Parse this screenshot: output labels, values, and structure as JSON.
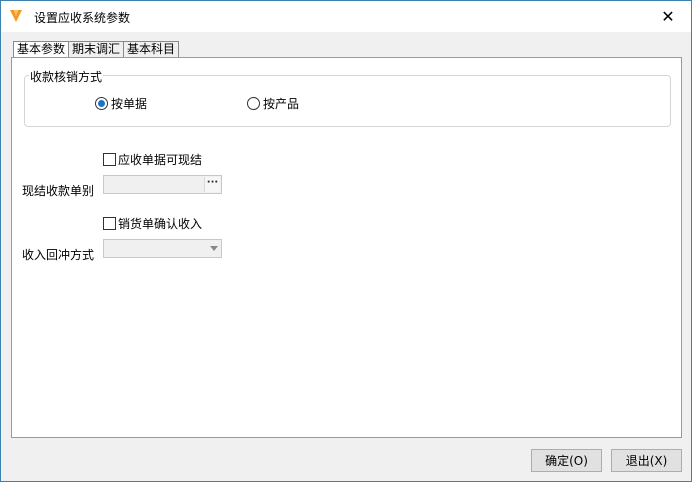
{
  "window": {
    "title": "设置应收系统参数",
    "close_glyph": "✕",
    "icon": "app-logo-icon"
  },
  "tabs": [
    {
      "label": "基本参数",
      "active": true
    },
    {
      "label": "期末调汇",
      "active": false
    },
    {
      "label": "基本科目",
      "active": false
    }
  ],
  "settlement_group": {
    "legend": "收款核销方式",
    "options": [
      {
        "label": "按单据",
        "checked": true
      },
      {
        "label": "按产品",
        "checked": false
      }
    ]
  },
  "checkbox_cash": {
    "label": "应收单据可现结",
    "checked": false
  },
  "cash_receipt_type": {
    "label": "现结收款单别",
    "value": "",
    "button_glyph": "···"
  },
  "checkbox_sales_confirm": {
    "label": "销货单确认收入",
    "checked": false
  },
  "revenue_reversal": {
    "label": "收入回冲方式",
    "value": ""
  },
  "buttons": {
    "ok": "确定(O)",
    "exit": "退出(X)"
  },
  "colors": {
    "title_bg": "#ffffff",
    "window_border": "#3c7fb1",
    "radio_dot": "#1a73c8",
    "icon_orange": "#f29a1f"
  }
}
